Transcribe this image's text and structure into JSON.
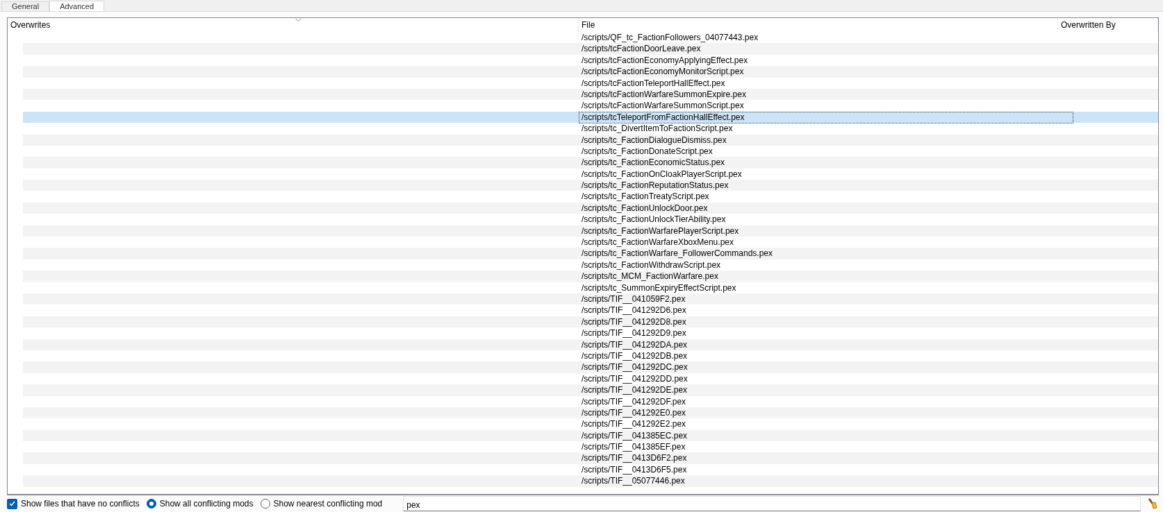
{
  "tabs": [
    {
      "label": "General",
      "selected": false
    },
    {
      "label": "Advanced",
      "selected": true
    }
  ],
  "table": {
    "columns": [
      "Overwrites",
      "File",
      "Overwritten By"
    ],
    "rows": [
      {
        "file": "/scripts/QF_tc_FactionFollowers_04077443.pex",
        "selected": false
      },
      {
        "file": "/scripts/tcFactionDoorLeave.pex",
        "selected": false
      },
      {
        "file": "/scripts/tcFactionEconomyApplyingEffect.pex",
        "selected": false
      },
      {
        "file": "/scripts/tcFactionEconomyMonitorScript.pex",
        "selected": false
      },
      {
        "file": "/scripts/tcFactionTeleportHallEffect.pex",
        "selected": false
      },
      {
        "file": "/scripts/tcFactionWarfareSummonExpire.pex",
        "selected": false
      },
      {
        "file": "/scripts/tcFactionWarfareSummonScript.pex",
        "selected": false
      },
      {
        "file": "/scripts/tcTeleportFromFactionHallEffect.pex",
        "selected": true
      },
      {
        "file": "/scripts/tc_DivertItemToFactionScript.pex",
        "selected": false
      },
      {
        "file": "/scripts/tc_FactionDialogueDismiss.pex",
        "selected": false
      },
      {
        "file": "/scripts/tc_FactionDonateScript.pex",
        "selected": false
      },
      {
        "file": "/scripts/tc_FactionEconomicStatus.pex",
        "selected": false
      },
      {
        "file": "/scripts/tc_FactionOnCloakPlayerScript.pex",
        "selected": false
      },
      {
        "file": "/scripts/tc_FactionReputationStatus.pex",
        "selected": false
      },
      {
        "file": "/scripts/tc_FactionTreatyScript.pex",
        "selected": false
      },
      {
        "file": "/scripts/tc_FactionUnlockDoor.pex",
        "selected": false
      },
      {
        "file": "/scripts/tc_FactionUnlockTierAbility.pex",
        "selected": false
      },
      {
        "file": "/scripts/tc_FactionWarfarePlayerScript.pex",
        "selected": false
      },
      {
        "file": "/scripts/tc_FactionWarfareXboxMenu.pex",
        "selected": false
      },
      {
        "file": "/scripts/tc_FactionWarfare_FollowerCommands.pex",
        "selected": false
      },
      {
        "file": "/scripts/tc_FactionWithdrawScript.pex",
        "selected": false
      },
      {
        "file": "/scripts/tc_MCM_FactionWarfare.pex",
        "selected": false
      },
      {
        "file": "/scripts/tc_SummonExpiryEffectScript.pex",
        "selected": false
      },
      {
        "file": "/scripts/TIF__041059F2.pex",
        "selected": false
      },
      {
        "file": "/scripts/TIF__041292D6.pex",
        "selected": false
      },
      {
        "file": "/scripts/TIF__041292D8.pex",
        "selected": false
      },
      {
        "file": "/scripts/TIF__041292D9.pex",
        "selected": false
      },
      {
        "file": "/scripts/TIF__041292DA.pex",
        "selected": false
      },
      {
        "file": "/scripts/TIF__041292DB.pex",
        "selected": false
      },
      {
        "file": "/scripts/TIF__041292DC.pex",
        "selected": false
      },
      {
        "file": "/scripts/TIF__041292DD.pex",
        "selected": false
      },
      {
        "file": "/scripts/TIF__041292DE.pex",
        "selected": false
      },
      {
        "file": "/scripts/TIF__041292DF.pex",
        "selected": false
      },
      {
        "file": "/scripts/TIF__041292E0.pex",
        "selected": false
      },
      {
        "file": "/scripts/TIF__041292E2.pex",
        "selected": false
      },
      {
        "file": "/scripts/TIF__041385EC.pex",
        "selected": false
      },
      {
        "file": "/scripts/TIF__041385EF.pex",
        "selected": false
      },
      {
        "file": "/scripts/TIF__0413D6F2.pex",
        "selected": false
      },
      {
        "file": "/scripts/TIF__0413D6F5.pex",
        "selected": false
      },
      {
        "file": "/scripts/TIF__05077446.pex",
        "selected": false
      }
    ]
  },
  "options": {
    "show_no_conflicts": {
      "label": "Show files that have no conflicts",
      "checked": true
    },
    "modes": [
      {
        "label": "Show all conflicting mods",
        "selected": true
      },
      {
        "label": "Show nearest conflicting mod",
        "selected": false
      }
    ]
  },
  "filter": {
    "value": "pex"
  }
}
